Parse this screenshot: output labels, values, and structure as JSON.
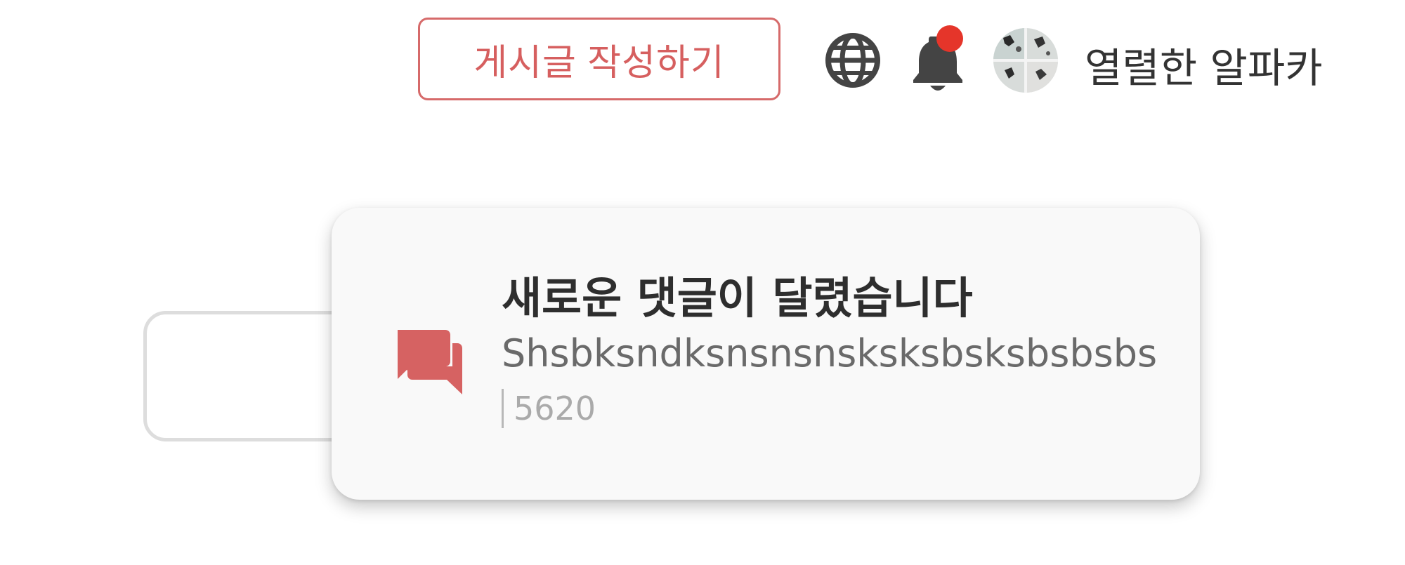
{
  "header": {
    "write_button_label": "게시글 작성하기",
    "globe_icon": "globe-icon",
    "bell_icon": "bell-icon",
    "has_unread_notifications": true,
    "username": "열렬한 알파카"
  },
  "notification": {
    "icon": "chat-bubbles-icon",
    "title": "새로운 댓글이 달렸습니다",
    "body": "Shsbksndksnsnsnsksksbsksbsbsbs",
    "meta": "5620"
  },
  "colors": {
    "accent": "#d66a6a",
    "badge": "#e5352a",
    "icon_dark": "#444444"
  }
}
